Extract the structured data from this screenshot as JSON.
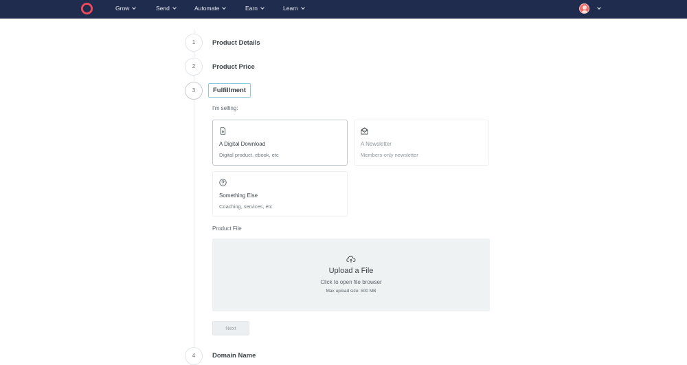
{
  "nav": {
    "items": [
      {
        "label": "Grow"
      },
      {
        "label": "Send"
      },
      {
        "label": "Automate"
      },
      {
        "label": "Earn"
      },
      {
        "label": "Learn"
      }
    ]
  },
  "steps": [
    {
      "number": "1",
      "title": "Product Details"
    },
    {
      "number": "2",
      "title": "Product Price"
    },
    {
      "number": "3",
      "title": "Fulfillment"
    },
    {
      "number": "4",
      "title": "Domain Name"
    }
  ],
  "fulfillment": {
    "selling_label": "I'm selling:",
    "options": [
      {
        "title": "A Digital Download",
        "description": "Digital product, ebook, etc",
        "icon": "download-file-icon",
        "selected": true
      },
      {
        "title": "A Newsletter",
        "description": "Members-only newsletter",
        "icon": "newsletter-icon",
        "selected": false
      },
      {
        "title": "Something Else",
        "description": "Coaching, services, etc",
        "icon": "question-circle-icon",
        "selected": false
      }
    ],
    "product_file_label": "Product File",
    "upload": {
      "title": "Upload a File",
      "subtitle": "Click to open file browser",
      "max_size": "Max upload size: 500 MB"
    },
    "next_label": "Next"
  },
  "colors": {
    "nav_bg": "#1f2c4d",
    "brand": "#f2495a",
    "active_outline": "#8ec9d6"
  }
}
